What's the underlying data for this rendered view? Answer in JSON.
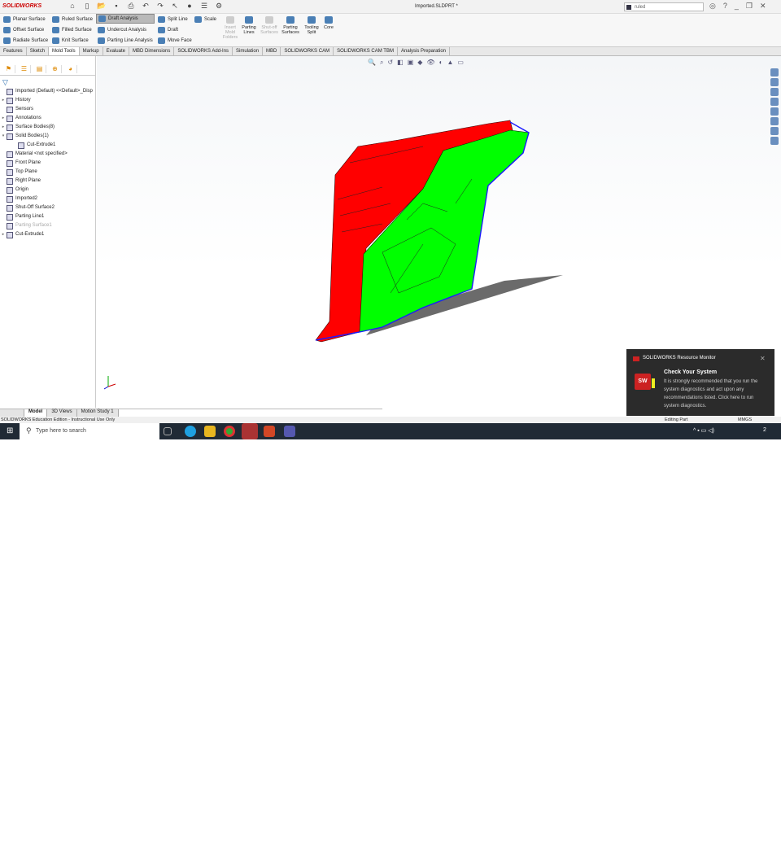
{
  "app": {
    "logo": "SOLIDWORKS",
    "doc_title": "Imported.SLDPRT *",
    "search_value": "ruled"
  },
  "ribbon": {
    "small": [
      {
        "label": "Planar Surface"
      },
      {
        "label": "Offset Surface"
      },
      {
        "label": "Radiate Surface"
      },
      {
        "label": "Ruled Surface"
      },
      {
        "label": "Filled Surface"
      },
      {
        "label": "Knit Surface"
      },
      {
        "label": "Draft Analysis",
        "selected": true
      },
      {
        "label": "Undercut Analysis"
      },
      {
        "label": "Parting Line Analysis"
      },
      {
        "label": "Split Line"
      },
      {
        "label": "Draft"
      },
      {
        "label": "Move Face"
      },
      {
        "label": "Scale"
      }
    ],
    "large": [
      {
        "label": "Insert Mold Folders",
        "disabled": true
      },
      {
        "label": "Parting Lines"
      },
      {
        "label": "Shut-off Surfaces",
        "disabled": true
      },
      {
        "label": "Parting Surfaces"
      },
      {
        "label": "Tooling Split"
      },
      {
        "label": "Core"
      }
    ]
  },
  "tabs": [
    "Features",
    "Sketch",
    "Mold Tools",
    "Markup",
    "Evaluate",
    "MBD Dimensions",
    "SOLIDWORKS Add-Ins",
    "Simulation",
    "MBD",
    "SOLIDWORKS CAM",
    "SOLIDWORKS CAM TBM",
    "Analysis Preparation"
  ],
  "active_tab": "Mold Tools",
  "tree": [
    {
      "label": "Imported (Default) <<Default>_Disp",
      "arrow": ""
    },
    {
      "label": "History",
      "arrow": "▸"
    },
    {
      "label": "Sensors",
      "arrow": ""
    },
    {
      "label": "Annotations",
      "arrow": "▸"
    },
    {
      "label": "Surface Bodies(8)",
      "arrow": "▸"
    },
    {
      "label": "Solid Bodies(1)",
      "arrow": "▾"
    },
    {
      "label": "Cut-Extrude1",
      "arrow": "",
      "indent": true
    },
    {
      "label": "Material <not specified>",
      "arrow": ""
    },
    {
      "label": "Front Plane",
      "arrow": ""
    },
    {
      "label": "Top Plane",
      "arrow": ""
    },
    {
      "label": "Right Plane",
      "arrow": ""
    },
    {
      "label": "Origin",
      "arrow": ""
    },
    {
      "label": "Imported2",
      "arrow": ""
    },
    {
      "label": "Shut-Off Surface2",
      "arrow": ""
    },
    {
      "label": "Parting Line1",
      "arrow": ""
    },
    {
      "label": "Parting Surface1",
      "arrow": "",
      "dim": true
    },
    {
      "label": "Cut-Extrude1",
      "arrow": "▸"
    }
  ],
  "bottom_tabs": [
    "Model",
    "3D Views",
    "Motion Study 1"
  ],
  "status": {
    "left": "SOLIDWORKS Education Edition - Instructional Use Only",
    "mode": "Editing Part",
    "units": "MMGS"
  },
  "notification": {
    "app": "SOLIDWORKS Resource Monitor",
    "title": "Check Your System",
    "body": "It is strongly recommended that you run the system diagnostics and act upon any recommendations listed. Click here to run system diagnostics."
  },
  "taskbar": {
    "search_placeholder": "Type here to search",
    "time": "17:12",
    "date": "12/04/2023",
    "notif_count": "2"
  },
  "colors": {
    "draft_positive": "#00ff00",
    "draft_negative": "#ff0000",
    "parting_line": "#1a1aff"
  }
}
